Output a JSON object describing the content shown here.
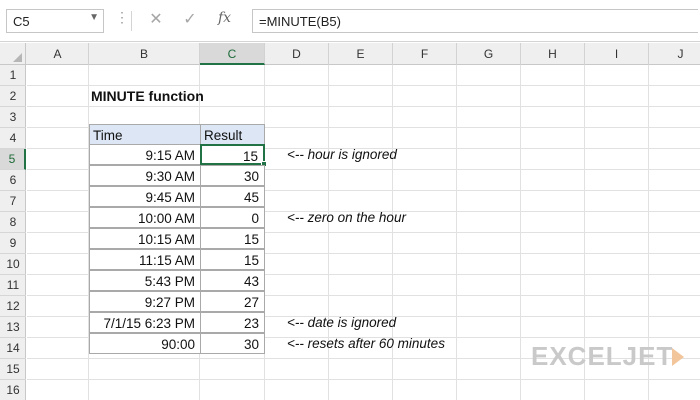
{
  "namebox": {
    "value": "C5"
  },
  "formula": {
    "value": "=MINUTE(B5)",
    "fx_label": "fx"
  },
  "columns": [
    "A",
    "B",
    "C",
    "D",
    "E",
    "F",
    "G",
    "H",
    "I",
    "J"
  ],
  "rows": [
    "1",
    "2",
    "3",
    "4",
    "5",
    "6",
    "7",
    "8",
    "9",
    "10",
    "11",
    "12",
    "13",
    "14",
    "15",
    "16"
  ],
  "active": {
    "column": "C",
    "row": "5"
  },
  "sheet": {
    "title": "MINUTE function",
    "headers": {
      "time": "Time",
      "result": "Result"
    },
    "data": [
      {
        "time": "9:15 AM",
        "result": "15",
        "note": "<-- hour is ignored"
      },
      {
        "time": "9:30 AM",
        "result": "30",
        "note": ""
      },
      {
        "time": "9:45 AM",
        "result": "45",
        "note": ""
      },
      {
        "time": "10:00 AM",
        "result": "0",
        "note": "<-- zero on the hour"
      },
      {
        "time": "10:15 AM",
        "result": "15",
        "note": ""
      },
      {
        "time": "11:15 AM",
        "result": "15",
        "note": ""
      },
      {
        "time": "5:43 PM",
        "result": "43",
        "note": ""
      },
      {
        "time": "9:27 PM",
        "result": "27",
        "note": ""
      },
      {
        "time": "7/1/15 6:23 PM",
        "result": "23",
        "note": "<-- date is ignored"
      },
      {
        "time": "90:00",
        "result": "30",
        "note": "<-- resets after 60 minutes"
      }
    ]
  },
  "logo": {
    "text": "EXCELJET"
  },
  "colors": {
    "accent": "#217346",
    "header_fill": "#dce6f4"
  }
}
